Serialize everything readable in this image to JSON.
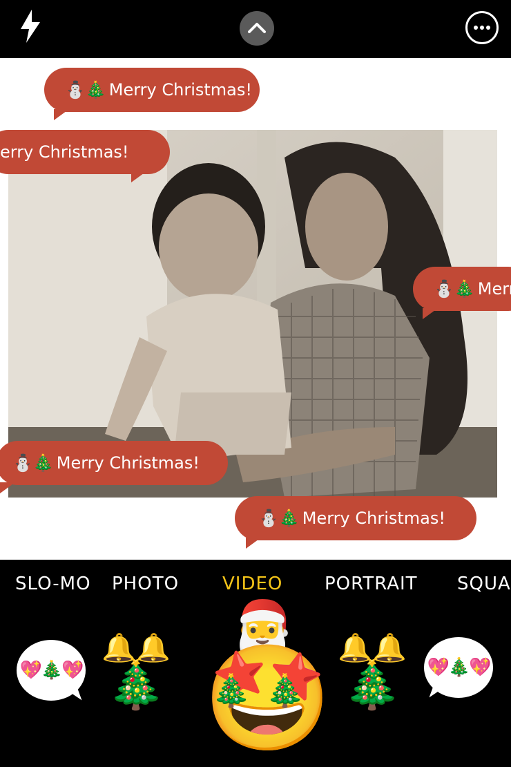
{
  "top_bar": {
    "flash_icon": "flash-icon",
    "expand_icon": "chevron-up-icon",
    "more_icon": "more-options-icon"
  },
  "bubbles": [
    {
      "emojis": "⛄🎄",
      "text": "Merry Christmas!"
    },
    {
      "emojis": "",
      "text": "erry Christmas!"
    },
    {
      "emojis": "⛄🎄",
      "text": "Merr"
    },
    {
      "emojis": "⛄🎄",
      "text": "Merry Christmas!"
    },
    {
      "emojis": "⛄🎄",
      "text": "Merry Christmas!"
    }
  ],
  "modes": [
    "SLO-MO",
    "PHOTO",
    "VIDEO",
    "PORTRAIT",
    "SQUA"
  ],
  "active_mode": "VIDEO",
  "stickers": {
    "speech_left": "💖🎄💖",
    "tree_left": "🎄",
    "bells": "🔔🔔",
    "face": "🤩",
    "hat": "🎅",
    "eyes": "🎄",
    "tree_right": "🎄",
    "speech_right": "💖🎄💖"
  },
  "colors": {
    "bubble": "#c14936",
    "active_mode": "#f5c518",
    "bar": "#000000"
  }
}
